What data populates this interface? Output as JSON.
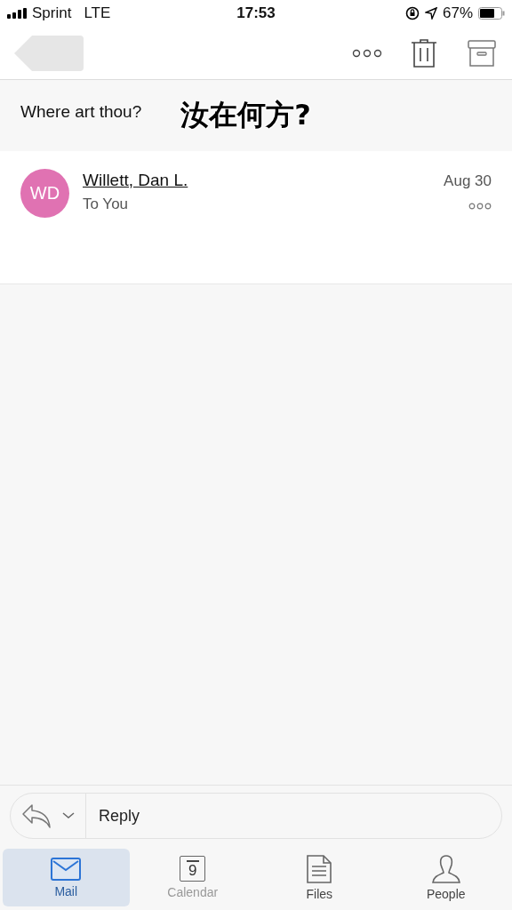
{
  "status_bar": {
    "carrier": "Sprint",
    "network": "LTE",
    "time": "17:53",
    "battery": "67%"
  },
  "subject": {
    "text": "Where art thou?",
    "caption": "汝在何方?"
  },
  "message": {
    "initials": "WD",
    "sender": "Willett, Dan L.",
    "recipient": "To You",
    "date": "Aug 30"
  },
  "reply": {
    "placeholder": "Reply"
  },
  "tabs": [
    {
      "label": "Mail",
      "kind": "mail",
      "selected": true,
      "disabled": false
    },
    {
      "label": "Calendar",
      "kind": "calendar",
      "icon_text": "9",
      "selected": false,
      "disabled": true
    },
    {
      "label": "Files",
      "kind": "files",
      "selected": false,
      "disabled": false
    },
    {
      "label": "People",
      "kind": "people",
      "selected": false,
      "disabled": false
    }
  ]
}
